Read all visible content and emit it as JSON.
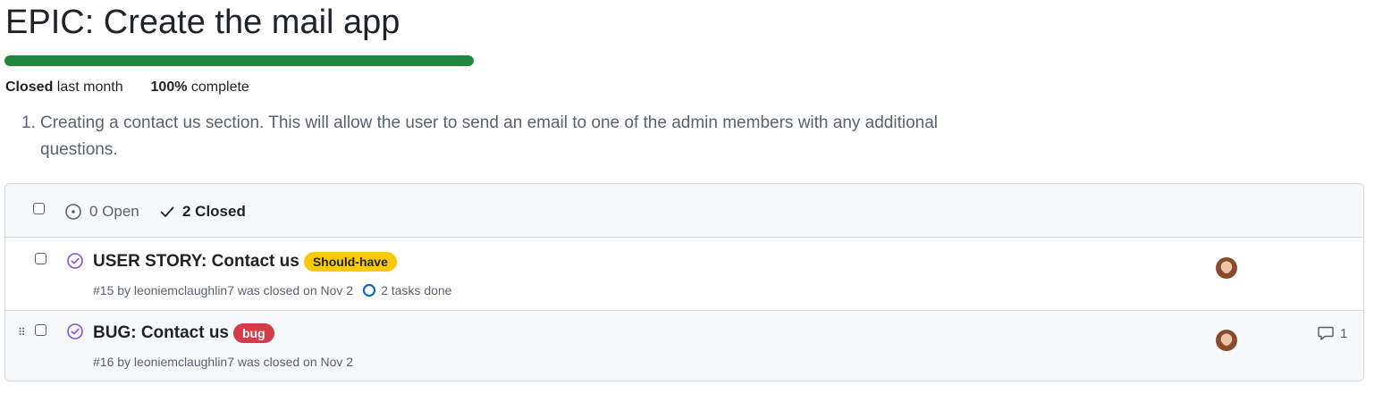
{
  "milestone": {
    "title": "EPIC: Create the mail app",
    "progress_percent": 100,
    "status_label": "Closed",
    "status_time": "last month",
    "complete_value": "100%",
    "complete_label": "complete",
    "accent_color": "#1f883d"
  },
  "description": {
    "item_number": "1.",
    "item_text": "Creating a contact us section. This will allow the user to send an email to one of the admin members with any additional questions."
  },
  "filters": {
    "open_label": "0 Open",
    "closed_label": "2 Closed"
  },
  "issues": [
    {
      "title": "USER STORY: Contact us",
      "label": "Should-have",
      "label_color": "#fbca04",
      "meta": "#15 by leoniemclaughlin7 was closed on Nov 2",
      "tasks": "2 tasks done",
      "comments": ""
    },
    {
      "title": "BUG: Contact us",
      "label": "bug",
      "label_color": "#d73a4a",
      "meta": "#16 by leoniemclaughlin7 was closed on Nov 2",
      "tasks": "",
      "comments": "1"
    }
  ]
}
